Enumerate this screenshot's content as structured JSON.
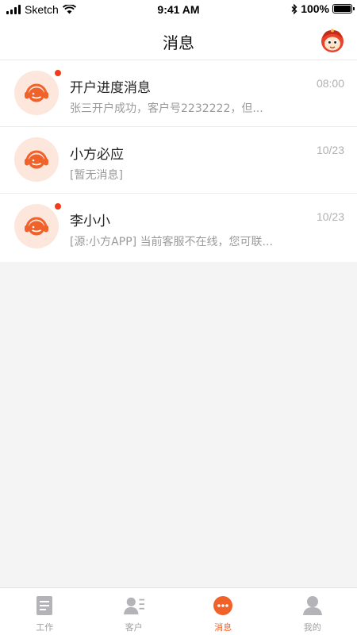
{
  "status_bar": {
    "carrier": "Sketch",
    "time": "9:41 AM",
    "battery": "100%"
  },
  "header": {
    "title": "消息"
  },
  "conversations": [
    {
      "title": "开户进度消息",
      "time": "08:00",
      "preview": "张三开户成功，客户号2232222，但...",
      "unread": true
    },
    {
      "title": "小方必应",
      "time": "10/23",
      "preview": "[暂无消息]",
      "unread": false
    },
    {
      "title": "李小小",
      "time": "10/23",
      "preview": "[源:小方APP] 当前客服不在线，您可联...",
      "unread": true
    }
  ],
  "tabbar": {
    "items": [
      {
        "label": "工作",
        "icon": "document-icon"
      },
      {
        "label": "客户",
        "icon": "contacts-icon"
      },
      {
        "label": "消息",
        "icon": "message-icon",
        "active": true
      },
      {
        "label": "我的",
        "icon": "person-icon"
      }
    ]
  },
  "colors": {
    "accent": "#f06229",
    "unread_dot": "#f23a1c",
    "avatar_bg": "#fde6dc",
    "inactive_tab": "#a0a0a0"
  }
}
